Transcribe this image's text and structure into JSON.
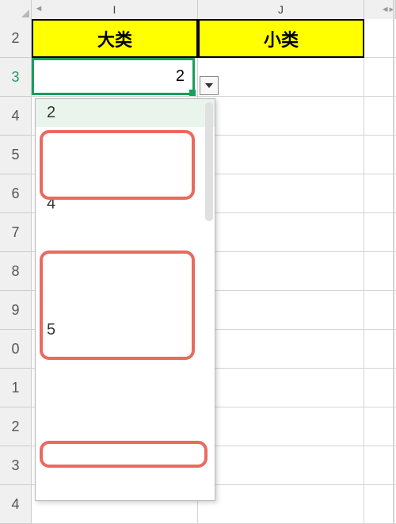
{
  "columns": {
    "I": "I",
    "J": "J"
  },
  "row_numbers": [
    "2",
    "3",
    "4",
    "5",
    "6",
    "7",
    "8",
    "9",
    "0",
    "1",
    "2",
    "3",
    "4"
  ],
  "active_row_index": 1,
  "headers": {
    "I": "大类",
    "J": "小类"
  },
  "active_cell": {
    "value": "2"
  },
  "dropdown": {
    "items": [
      "2",
      "",
      "",
      "4",
      "",
      "",
      "",
      "5",
      ""
    ],
    "selected_index": 0
  },
  "colors": {
    "header_bg": "#ffff00",
    "active_border": "#1a9e5c",
    "annotation": "#ea6a5f"
  }
}
